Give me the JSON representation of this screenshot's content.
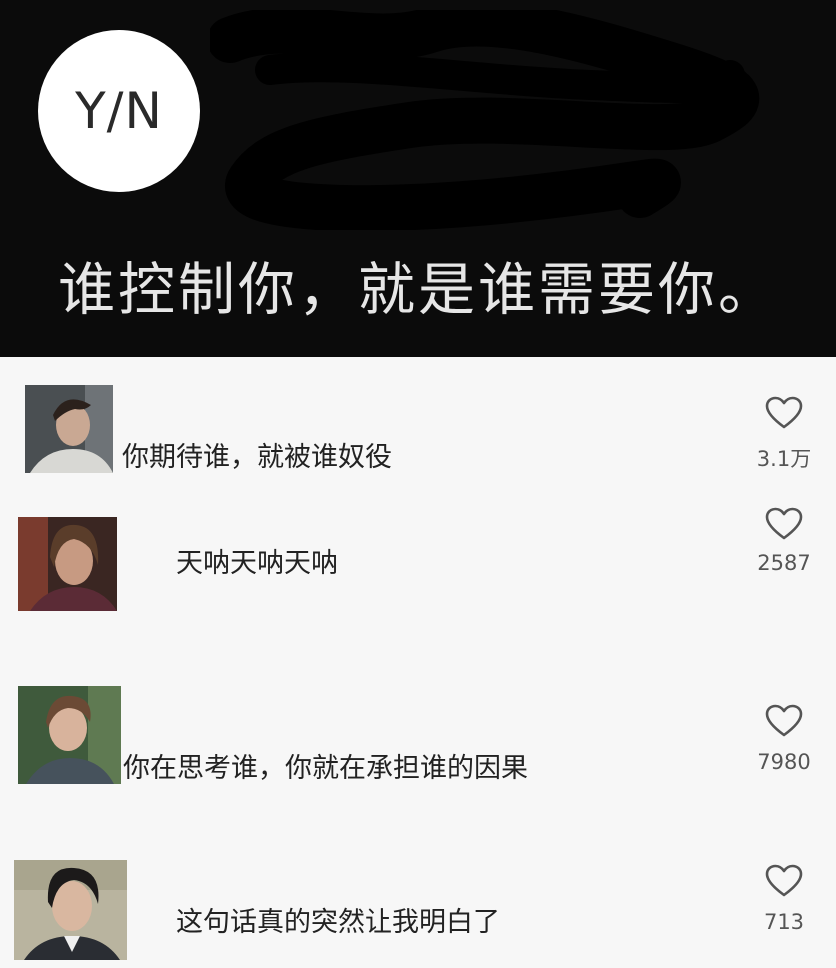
{
  "header": {
    "avatar_text": "Y/N",
    "quote": "谁控制你，就是谁需要你。"
  },
  "comments": [
    {
      "text": "你期待谁，就被谁奴役",
      "likes": "3.1万"
    },
    {
      "text": "天呐天呐天呐",
      "likes": "2587"
    },
    {
      "text": "你在思考谁，你就在承担谁的因果",
      "likes": "7980"
    },
    {
      "text": "这句话真的突然让我明白了",
      "likes": "713"
    }
  ],
  "icons": {
    "like": "heart-outline-icon",
    "avatar": "user-avatar-photo"
  },
  "colors": {
    "header_bg": "#0b0b0b",
    "quote_text": "#e6e6e6",
    "body_bg": "#f7f7f7",
    "heart_stroke": "#555555"
  }
}
